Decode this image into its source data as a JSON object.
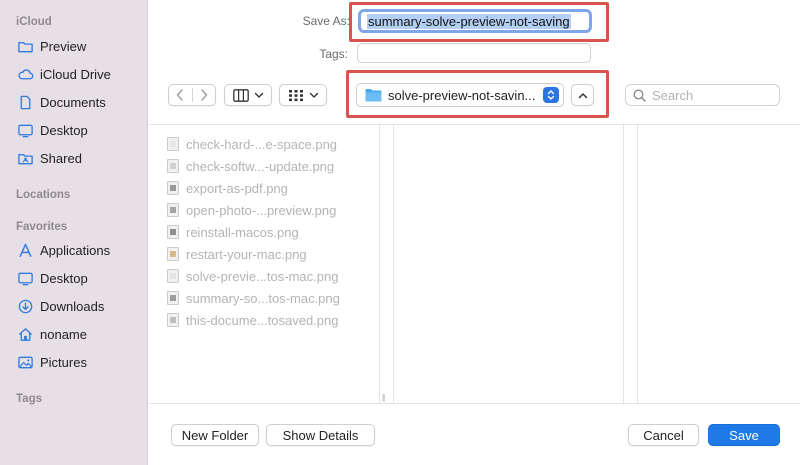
{
  "sidebar": {
    "sections": [
      {
        "label": "iCloud",
        "items": [
          {
            "label": "Preview",
            "icon": "folder-icon"
          },
          {
            "label": "iCloud Drive",
            "icon": "cloud-icon"
          },
          {
            "label": "Documents",
            "icon": "document-icon"
          },
          {
            "label": "Desktop",
            "icon": "desktop-icon"
          },
          {
            "label": "Shared",
            "icon": "shared-folder-icon"
          }
        ]
      },
      {
        "label": "Locations",
        "items": []
      },
      {
        "label": "Favorites",
        "items": [
          {
            "label": "Applications",
            "icon": "applications-icon"
          },
          {
            "label": "Desktop",
            "icon": "desktop-icon"
          },
          {
            "label": "Downloads",
            "icon": "downloads-icon"
          },
          {
            "label": "noname",
            "icon": "home-icon"
          },
          {
            "label": "Pictures",
            "icon": "pictures-icon"
          }
        ]
      },
      {
        "label": "Tags",
        "items": []
      }
    ]
  },
  "header": {
    "save_as_label": "Save As:",
    "save_as_value": "summary-solve-preview-not-saving",
    "tags_label": "Tags:",
    "tags_value": "",
    "location_value": "solve-preview-not-savin...",
    "search_placeholder": "Search"
  },
  "files": [
    {
      "name": "check-hard-...e-space.png"
    },
    {
      "name": "check-softw...-update.png"
    },
    {
      "name": "export-as-pdf.png"
    },
    {
      "name": "open-photo-...preview.png"
    },
    {
      "name": "reinstall-macos.png"
    },
    {
      "name": "restart-your-mac.png"
    },
    {
      "name": "solve-previe...tos-mac.png"
    },
    {
      "name": "summary-so...tos-mac.png"
    },
    {
      "name": "this-docume...tosaved.png"
    }
  ],
  "footer": {
    "new_folder": "New Folder",
    "show_details": "Show Details",
    "cancel": "Cancel",
    "save": "Save"
  },
  "colors": {
    "accent": "#1f7ae8",
    "highlight_box": "#d9534f",
    "sidebar_bg": "#e6dfe6",
    "file_text_disabled": "#b4b4b4"
  }
}
